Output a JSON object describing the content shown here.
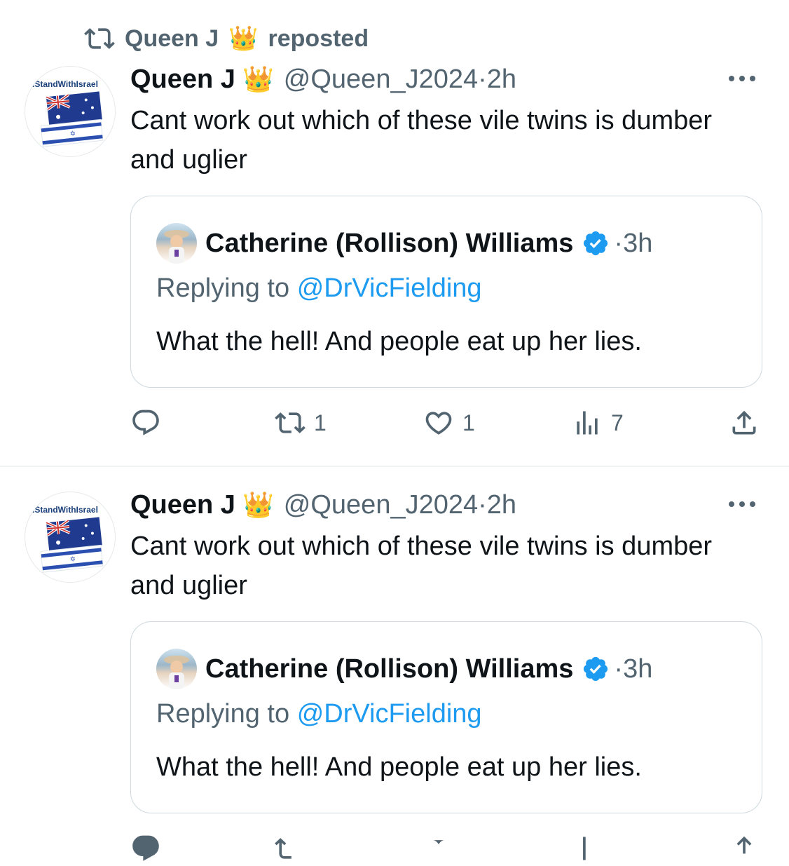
{
  "repost": {
    "user": "Queen J",
    "crown": "👑",
    "label": "reposted",
    "icon": "repost-icon"
  },
  "tweets": [
    {
      "avatar_text": "IStandWithIsrael",
      "name": "Queen J",
      "crown": "👑",
      "handle": "@Queen_J2024",
      "time": "2h",
      "text": "Cant work out which of these vile twins is dumber and uglier",
      "quote": {
        "name": "Catherine (Rollison) Williams",
        "time": "3h",
        "replying_label": "Replying to",
        "replying_to": "@DrVicFielding",
        "text": "What the hell! And people eat up her lies."
      },
      "stats": {
        "replies": "",
        "reposts": "1",
        "likes": "1",
        "views": "7"
      }
    },
    {
      "avatar_text": "IStandWithIsrael",
      "name": "Queen J",
      "crown": "👑",
      "handle": "@Queen_J2024",
      "time": "2h",
      "text": "Cant work out which of these vile twins is dumber and uglier",
      "quote": {
        "name": "Catherine (Rollison) Williams",
        "time": "3h",
        "replying_label": "Replying to",
        "replying_to": "@DrVicFielding",
        "text": "What the hell! And people eat up her lies."
      }
    }
  ],
  "colors": {
    "accent": "#1d9bf0",
    "muted": "#536471",
    "text": "#0f1419",
    "border": "#cfd9de"
  }
}
